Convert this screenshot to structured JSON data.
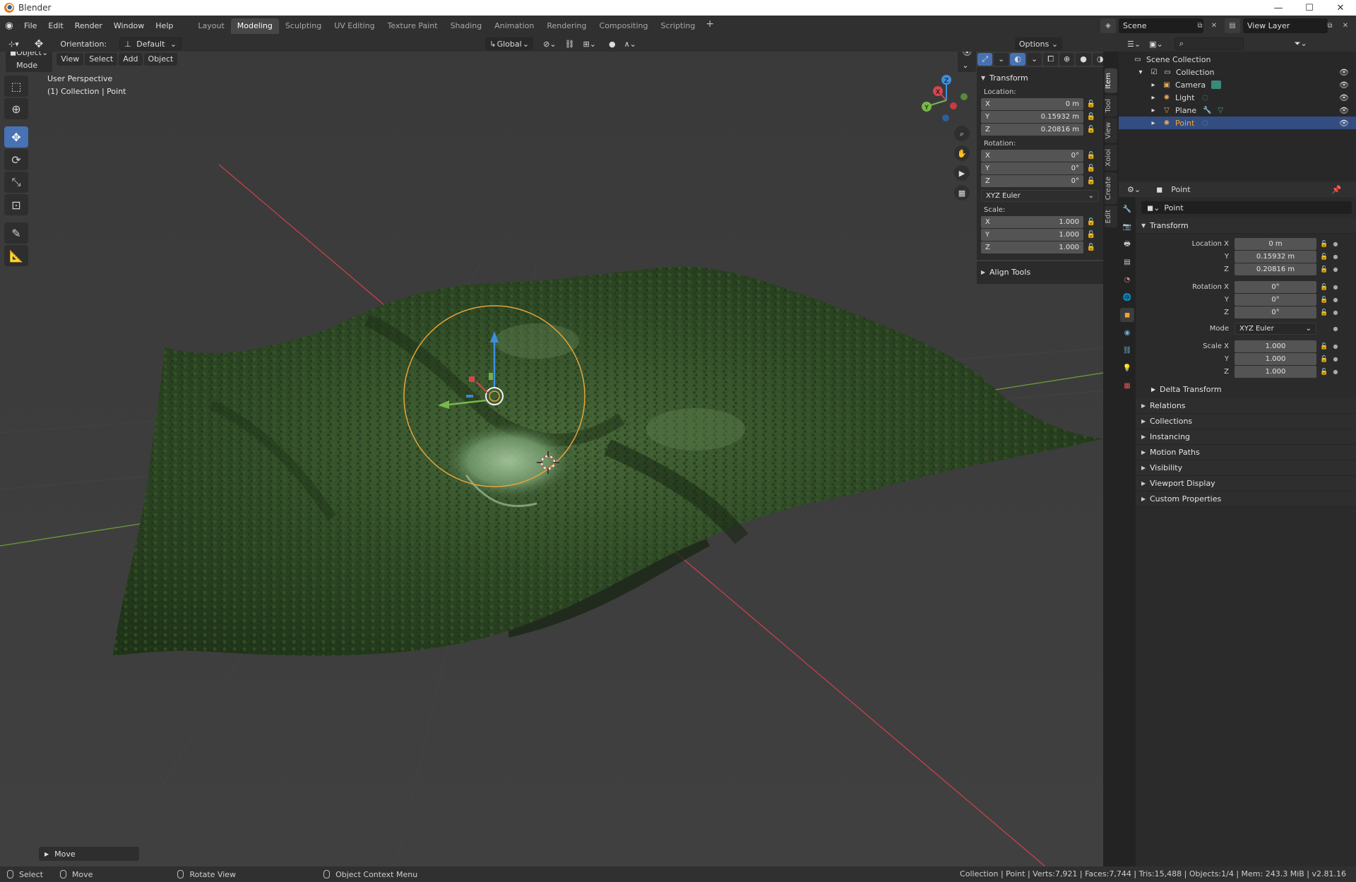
{
  "window": {
    "title": "Blender",
    "controls": [
      "—",
      "☐",
      "✕"
    ]
  },
  "menu": [
    "File",
    "Edit",
    "Render",
    "Window",
    "Help"
  ],
  "workspaces": [
    {
      "label": "Layout"
    },
    {
      "label": "Modeling"
    },
    {
      "label": "Sculpting"
    },
    {
      "label": "UV Editing"
    },
    {
      "label": "Texture Paint"
    },
    {
      "label": "Shading"
    },
    {
      "label": "Animation"
    },
    {
      "label": "Rendering"
    },
    {
      "label": "Compositing"
    },
    {
      "label": "Scripting"
    }
  ],
  "active_workspace": "Modeling",
  "scene": {
    "name": "Scene",
    "view_layer": "View Layer"
  },
  "tool_header": {
    "orientation_label": "Orientation:",
    "orientation_value": "Default",
    "transform_orientation": "Global",
    "options": "Options"
  },
  "viewport_header": {
    "mode": "Object Mode",
    "menus": [
      "View",
      "Select",
      "Add",
      "Object"
    ]
  },
  "viewport_overlay": {
    "perspective": "User Perspective",
    "collection": "(1) Collection | Point"
  },
  "gizmo_axes": {
    "x": "X",
    "y": "Y",
    "z": "Z"
  },
  "npanel": {
    "title": "Transform",
    "location_label": "Location:",
    "location": [
      {
        "axis": "X",
        "value": "0 m"
      },
      {
        "axis": "Y",
        "value": "0.15932 m"
      },
      {
        "axis": "Z",
        "value": "0.20816 m"
      }
    ],
    "rotation_label": "Rotation:",
    "rotation": [
      {
        "axis": "X",
        "value": "0°"
      },
      {
        "axis": "Y",
        "value": "0°"
      },
      {
        "axis": "Z",
        "value": "0°"
      }
    ],
    "rotation_mode": "XYZ Euler",
    "scale_label": "Scale:",
    "scale": [
      {
        "axis": "X",
        "value": "1.000"
      },
      {
        "axis": "Y",
        "value": "1.000"
      },
      {
        "axis": "Z",
        "value": "1.000"
      }
    ],
    "align_tools": "Align Tools",
    "tabs": [
      "Item",
      "Tool",
      "View",
      "Xoioi",
      "Create",
      "Edit"
    ]
  },
  "outliner": {
    "root": "Scene Collection",
    "collection": "Collection",
    "items": [
      {
        "label": "Camera",
        "color": "#e8a95b"
      },
      {
        "label": "Light",
        "color": "#e8a95b"
      },
      {
        "label": "Plane",
        "color": "#e8a95b"
      },
      {
        "label": "Point",
        "color": "#e8a95b"
      }
    ],
    "selected": "Point"
  },
  "properties": {
    "header": "Point",
    "object_name": "Point",
    "transform_title": "Transform",
    "location": [
      {
        "label": "Location X",
        "value": "0 m"
      },
      {
        "label": "Y",
        "value": "0.15932 m"
      },
      {
        "label": "Z",
        "value": "0.20816 m"
      }
    ],
    "rotation": [
      {
        "label": "Rotation X",
        "value": "0°"
      },
      {
        "label": "Y",
        "value": "0°"
      },
      {
        "label": "Z",
        "value": "0°"
      }
    ],
    "mode_label": "Mode",
    "mode_value": "XYZ Euler",
    "scale": [
      {
        "label": "Scale X",
        "value": "1.000"
      },
      {
        "label": "Y",
        "value": "1.000"
      },
      {
        "label": "Z",
        "value": "1.000"
      }
    ],
    "delta": "Delta Transform",
    "panels": [
      "Relations",
      "Collections",
      "Instancing",
      "Motion Paths",
      "Visibility",
      "Viewport Display",
      "Custom Properties"
    ]
  },
  "last_operator": "Move",
  "statusbar": {
    "select": "Select",
    "move": "Move",
    "rotate": "Rotate View",
    "context": "Object Context Menu",
    "stats": "Collection | Point | Verts:7,921 | Faces:7,744 | Tris:15,488 | Objects:1/4 | Mem: 243.3 MiB | v2.81.16"
  },
  "colors": {
    "accent": "#4772b3",
    "selection": "#334d80",
    "light_ring": "#e8a43a",
    "x_axis": "#d6454f",
    "y_axis": "#78b84a",
    "z_axis": "#3e8ee0"
  }
}
